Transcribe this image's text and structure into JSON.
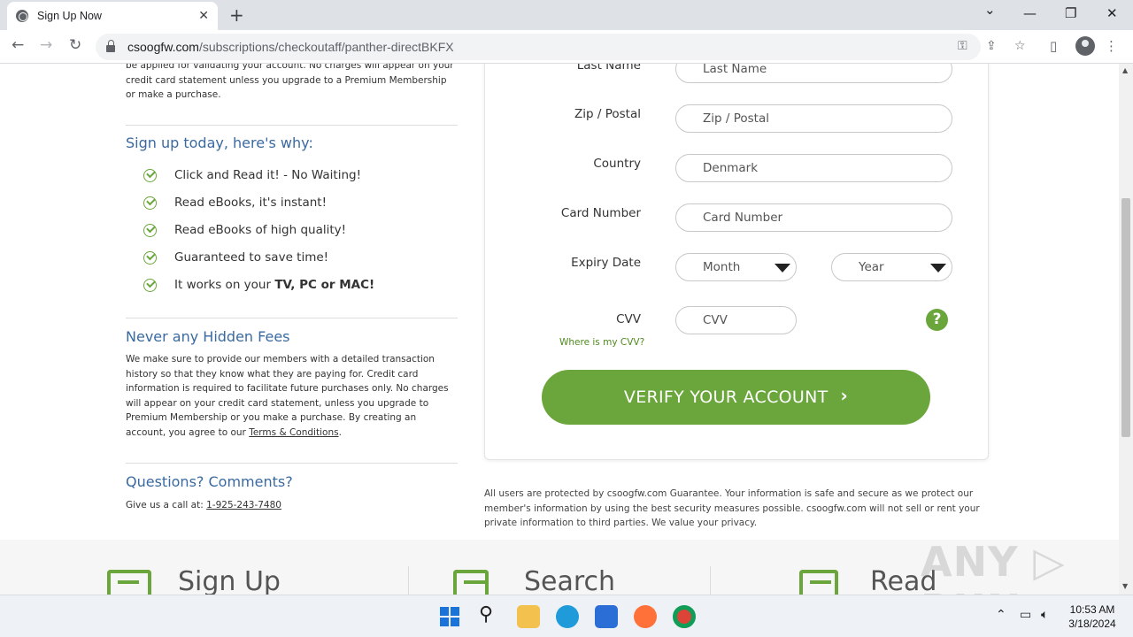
{
  "browser": {
    "tab_title": "Sign Up Now",
    "tab_close": "✕",
    "new_tab": "+",
    "url_host": "csoogfw.com",
    "url_path": "/subscriptions/checkoutaff/panther-directBKFX",
    "controls": {
      "dropdown": "⌄",
      "minimize": "—",
      "restore": "❐",
      "close": "✕"
    }
  },
  "left": {
    "intro_text": "be applied for validating your account. No charges will appear on your credit card statement unless you upgrade to a Premium Membership or make a purchase.",
    "why_title": "Sign up today, here's why:",
    "benefits": [
      {
        "text": "Click and Read it! - No Waiting!"
      },
      {
        "text": "Read eBooks, it's instant!"
      },
      {
        "text": "Read eBooks of high quality!"
      },
      {
        "text": "Guaranteed to save time!"
      },
      {
        "text_pre": "It works on your ",
        "text_bold": "TV, PC or MAC!"
      }
    ],
    "fees_title": "Never any Hidden Fees",
    "fees_text": "We make sure to provide our members with a detailed transaction history so that they know what they are paying for. Credit card information is required to facilitate future purchases only. No charges will appear on your credit card statement, unless you upgrade to Premium Membership or you make a purchase. By creating an account, you agree to our ",
    "terms_link": "Terms & Conditions",
    "fees_end": ".",
    "questions_title": "Questions? Comments?",
    "call_text": "Give us a call at: ",
    "phone": "1-925-243-7480"
  },
  "form": {
    "last_name_label": "Last Name",
    "last_name_placeholder": "Last Name",
    "zip_label": "Zip / Postal",
    "zip_placeholder": "Zip / Postal",
    "country_label": "Country",
    "country_value": "Denmark",
    "card_label": "Card Number",
    "card_placeholder": "Card Number",
    "expiry_label": "Expiry Date",
    "month_value": "Month",
    "year_value": "Year",
    "cvv_label": "CVV",
    "cvv_placeholder": "CVV",
    "cvv_help": "?",
    "cvv_link": "Where is my CVV?",
    "submit_label": "VERIFY YOUR ACCOUNT",
    "submit_chevron": "›"
  },
  "guarantee_text": "All users are protected by csoogfw.com Guarantee. Your information is safe and secure as we protect our member's information by using the best security measures possible. csoogfw.com will not sell or rent your private information to third parties. We value your privacy.",
  "footer_steps": [
    "Sign Up",
    "Search",
    "Read"
  ],
  "watermark": "ANY ▷ RUN",
  "taskbar": {
    "time": "10:53 AM",
    "date": "3/18/2024"
  },
  "colors": {
    "accent_green": "#6aa63b",
    "heading_blue": "#3a6aa0"
  }
}
